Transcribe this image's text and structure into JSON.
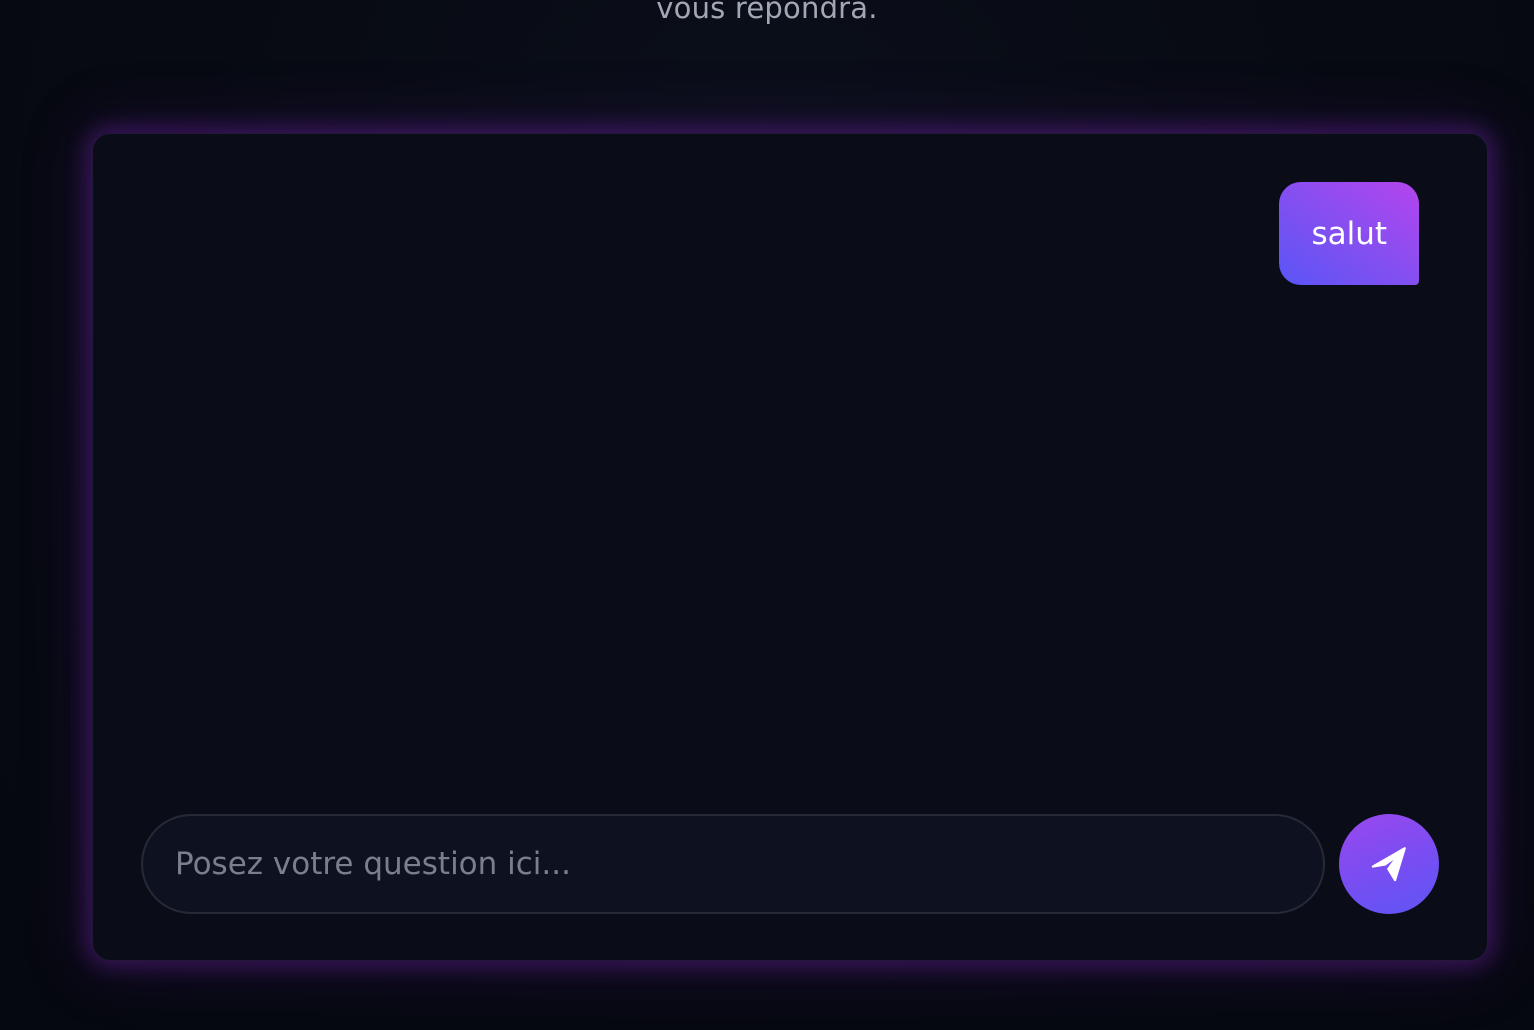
{
  "header": {
    "subtitle_tail": "vous répondra."
  },
  "chat": {
    "messages": [
      {
        "role": "user",
        "text": "salut"
      }
    ]
  },
  "composer": {
    "placeholder": "Posez votre question ici...",
    "value": "",
    "send_icon": "paper-plane-icon"
  },
  "colors": {
    "background": "#070a12",
    "card": "#0a0d18",
    "glow": "#8b2cd2",
    "bubble_gradient_start": "#5a55f6",
    "bubble_gradient_end": "#b544ee",
    "placeholder": "#7b7f8b"
  }
}
